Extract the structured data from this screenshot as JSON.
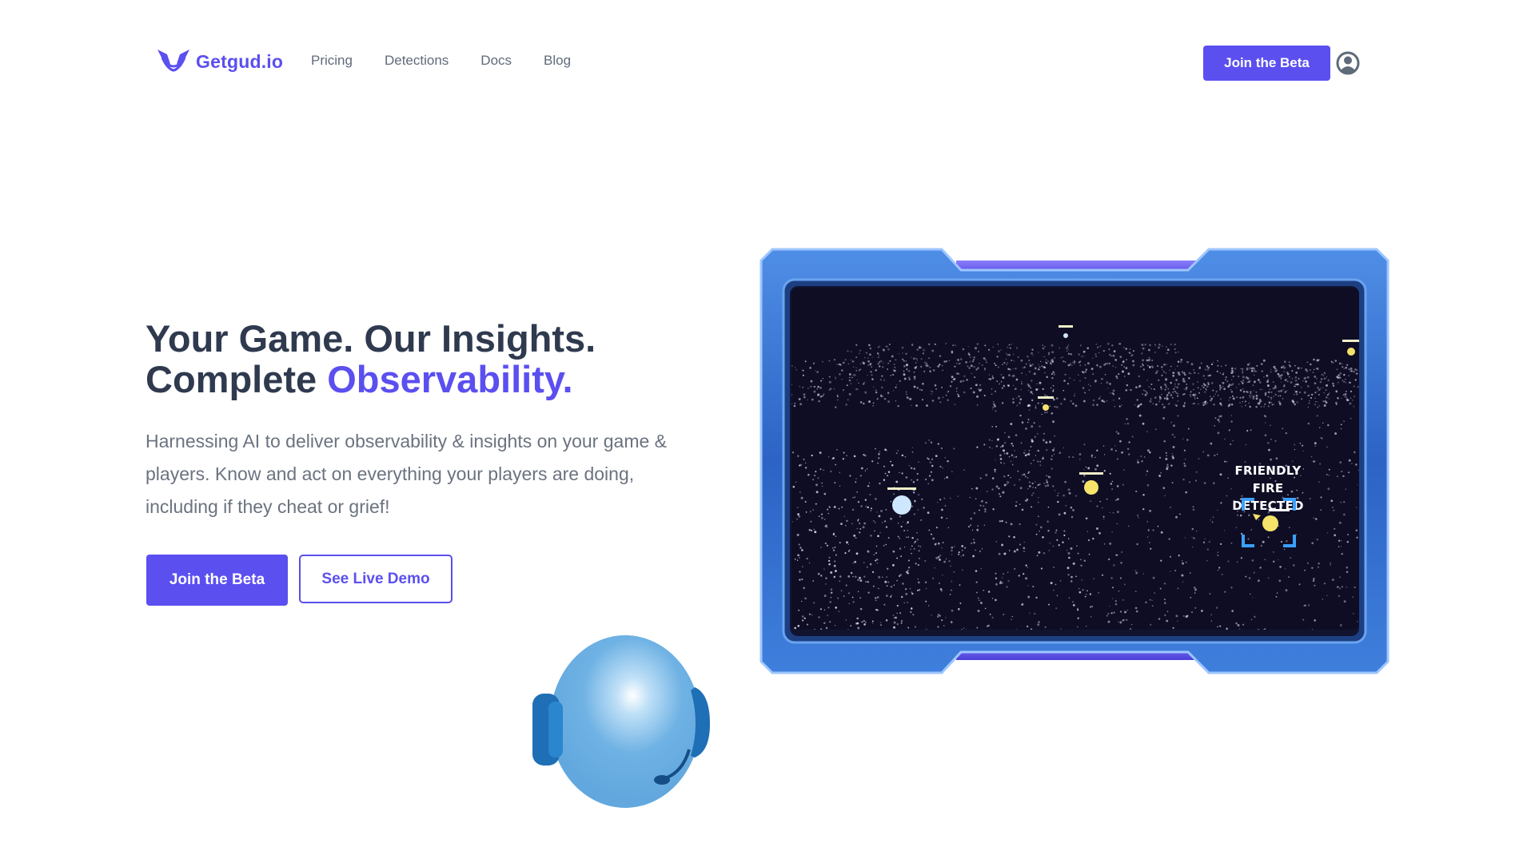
{
  "brand": {
    "name": "Getgud.io",
    "logo_icon": "winged-mask-icon",
    "color": "#5b4ff0"
  },
  "nav": {
    "links": [
      "Pricing",
      "Detections",
      "Docs",
      "Blog"
    ],
    "cta_label": "Join the Beta",
    "user_icon": "user-circle-icon"
  },
  "hero": {
    "title_line1": "Your Game. Our Insights.",
    "title_line2_prefix": "Complete ",
    "title_line2_accent": "Observability.",
    "subtitle": "Harnessing AI to deliver observability & insights on your game & players. Know and act on everything your players are doing, including if they cheat or grief!",
    "primary_button": "Join the Beta",
    "secondary_button": "See Live Demo"
  },
  "game_preview": {
    "overlay_line1": "FRIENDLY FIRE",
    "overlay_line2": "DETECTED"
  },
  "colors": {
    "accent": "#5b4ff0",
    "heading": "#2f3a4f",
    "body_text": "#6b7380",
    "frame_blue": "#2f67c9",
    "screen_bg": "#0e0d24"
  }
}
